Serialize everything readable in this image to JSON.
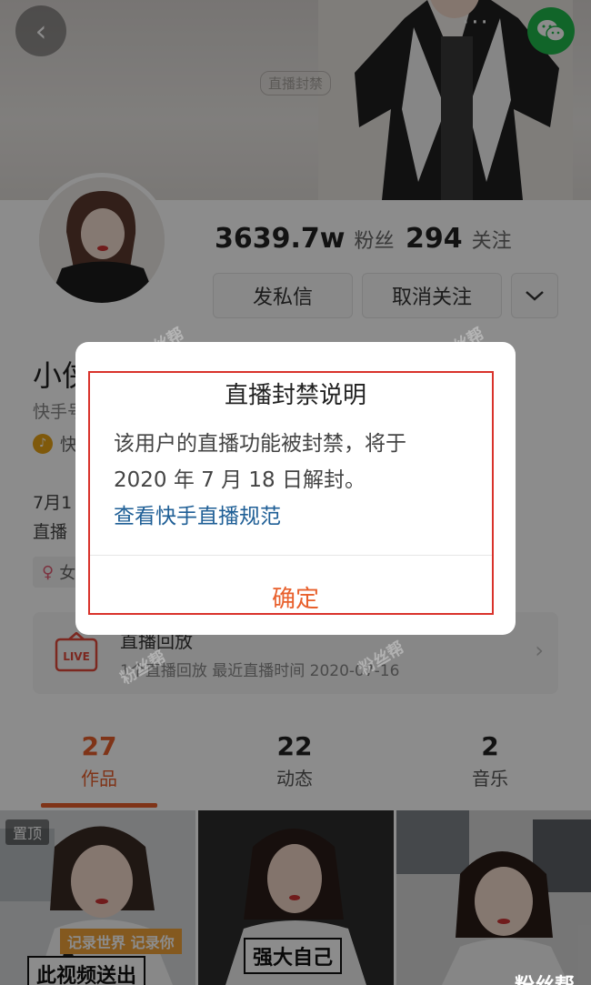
{
  "cover": {
    "tag": "直播封禁",
    "back_icon": "chevron-left-icon",
    "more_icon": "more-dots-icon",
    "share_icon": "wechat-icon"
  },
  "profile": {
    "fans_count": "3639.7w",
    "fans_label": "粉丝",
    "following_count": "294",
    "following_label": "关注",
    "message_button": "发私信",
    "unfollow_button": "取消关注",
    "name": "小侠",
    "kuaishou_id": "快手号",
    "badge_text": "快",
    "bio_line1": "7月1",
    "bio_line2": "直播",
    "gender_text": "女"
  },
  "replay": {
    "icon_text": "LIVE",
    "title": "直播回放",
    "subtitle": "1个直播回放 最近直播时间 2020-07-16"
  },
  "tabs": [
    {
      "count": "27",
      "label": "作品",
      "active": true
    },
    {
      "count": "22",
      "label": "动态",
      "active": false
    },
    {
      "count": "2",
      "label": "音乐",
      "active": false
    }
  ],
  "grid": {
    "pinned_label": "置顶",
    "tile1_banner": "记录世界 记录你",
    "tile1_caption": "此视频送出",
    "tile2_caption": "强大自己"
  },
  "watermark": {
    "text": "粉丝帮",
    "corner_text": "粉丝帮"
  },
  "dialog": {
    "title": "直播封禁说明",
    "message_line1": "该用户的直播功能被封禁，将于",
    "message_line2": "2020 年 7 月 18 日解封。",
    "link_text": "查看快手直播规范",
    "ok_button": "确定"
  },
  "colors": {
    "accent": "#e8602c",
    "link": "#1f5f96",
    "highlight_frame": "#d9322b",
    "wechat_green": "#1fb84b"
  }
}
